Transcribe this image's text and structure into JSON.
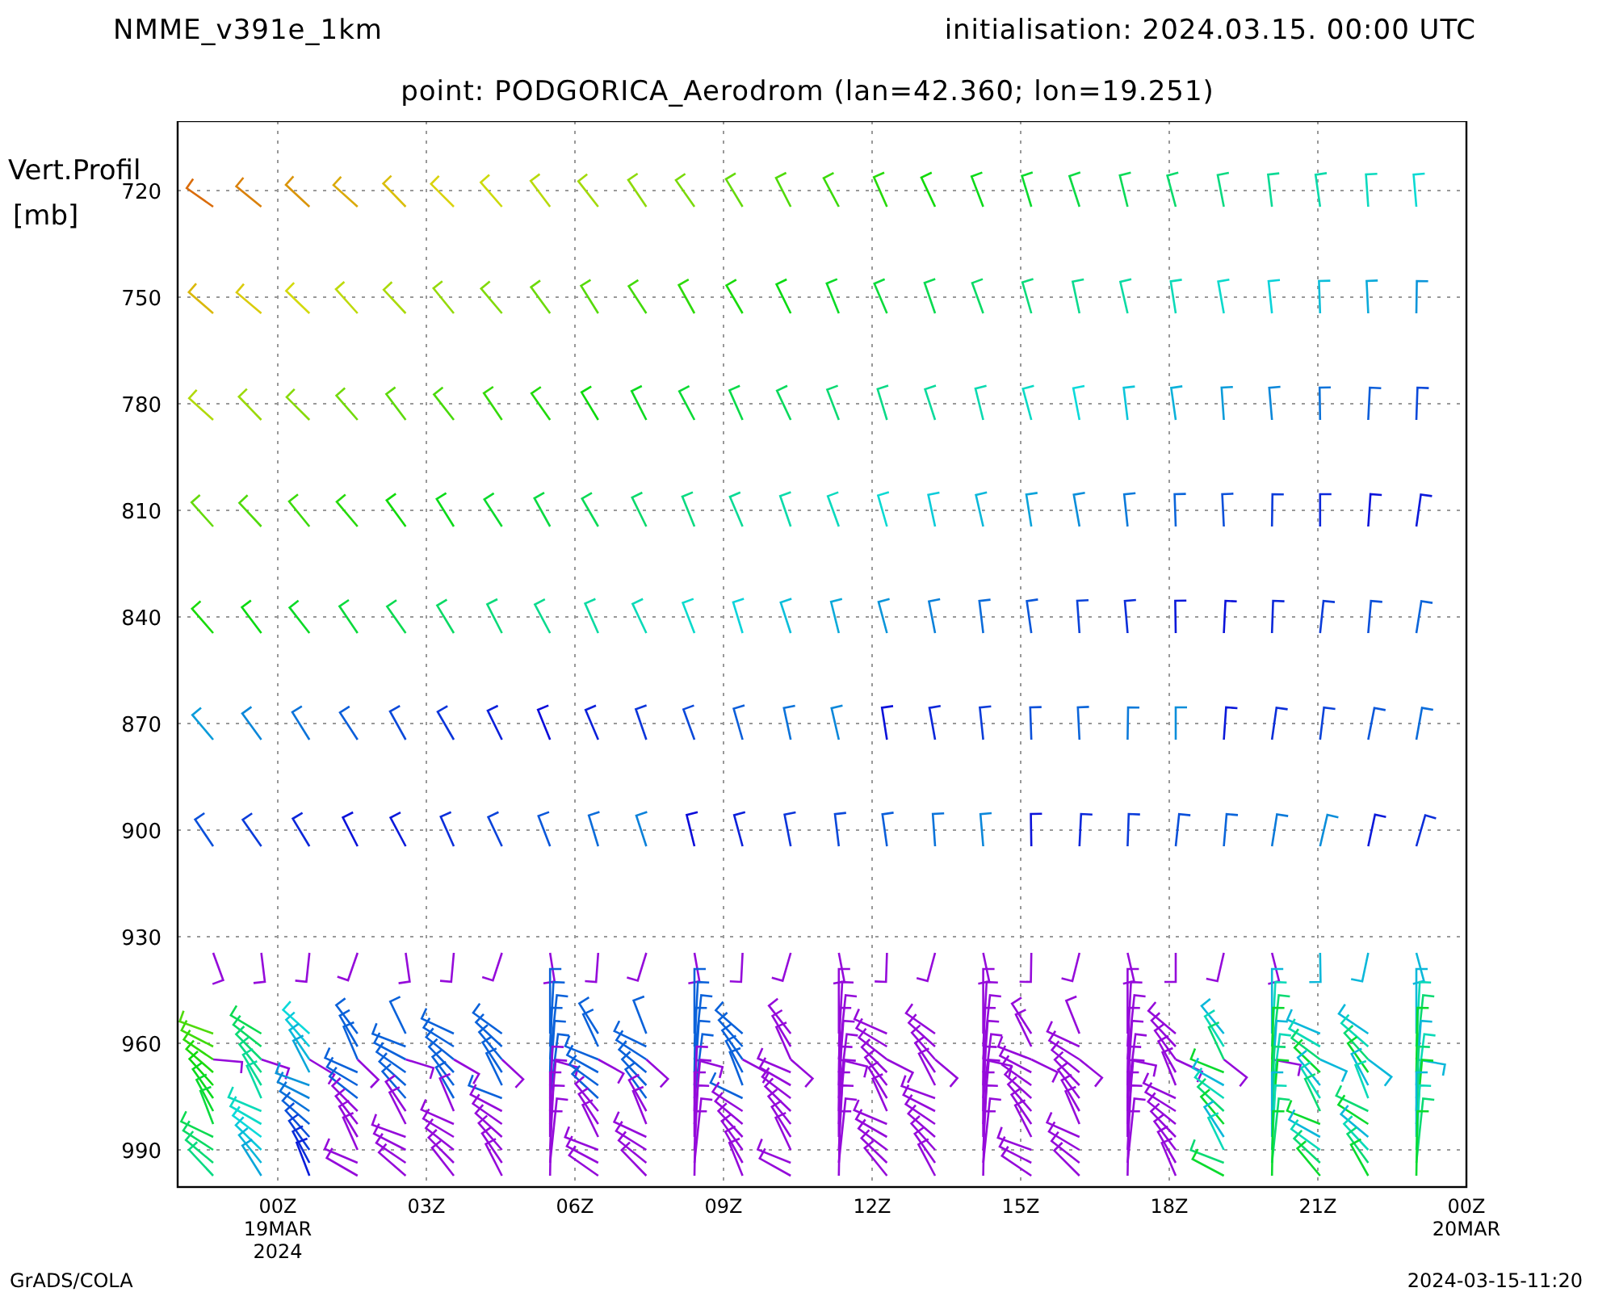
{
  "header": {
    "model": "NMME_v391e_1km",
    "initialisation": "initialisation: 2024.03.15. 00:00 UTC",
    "point": "point: PODGORICA_Aerodrom (lan=42.360; lon=19.251)"
  },
  "chart": {
    "ylabel_lines": [
      "Vert.Profil",
      "[mb]"
    ],
    "yticks": [
      "720",
      "750",
      "780",
      "810",
      "840",
      "870",
      "900",
      "930",
      "960",
      "990"
    ],
    "xticks": [
      {
        "lines": [
          "00Z",
          "19MAR",
          "2024"
        ]
      },
      {
        "lines": [
          "03Z"
        ]
      },
      {
        "lines": [
          "06Z"
        ]
      },
      {
        "lines": [
          "09Z"
        ]
      },
      {
        "lines": [
          "12Z"
        ]
      },
      {
        "lines": [
          "15Z"
        ]
      },
      {
        "lines": [
          "18Z"
        ]
      },
      {
        "lines": [
          "21Z"
        ]
      },
      {
        "lines": [
          "00Z",
          "20MAR"
        ]
      }
    ]
  },
  "footer": {
    "left": "GrADS/COLA",
    "right": "2024-03-15-11:20"
  }
}
